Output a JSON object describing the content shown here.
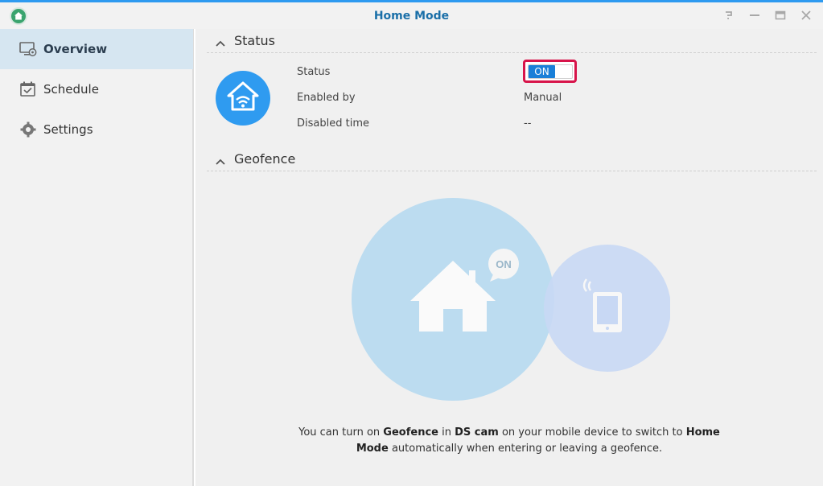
{
  "window": {
    "title": "Home Mode"
  },
  "sidebar": {
    "items": [
      {
        "label": "Overview"
      },
      {
        "label": "Schedule"
      },
      {
        "label": "Settings"
      }
    ]
  },
  "status_section": {
    "title": "Status",
    "rows": [
      {
        "label": "Status",
        "value": "ON"
      },
      {
        "label": "Enabled by",
        "value": "Manual"
      },
      {
        "label": "Disabled time",
        "value": "--"
      }
    ]
  },
  "geofence_section": {
    "title": "Geofence",
    "bubble_text": "ON",
    "desc": {
      "p1": "You can turn on ",
      "b1": "Geofence",
      "p2": " in ",
      "b2": "DS cam",
      "p3": " on your mobile device to switch to ",
      "b3": "Home Mode",
      "p4": " automatically when entering or leaving a geofence."
    }
  },
  "colors": {
    "accent": "#2e9af0",
    "highlight": "#d7144a",
    "toggle_on": "#1a7fd8"
  }
}
